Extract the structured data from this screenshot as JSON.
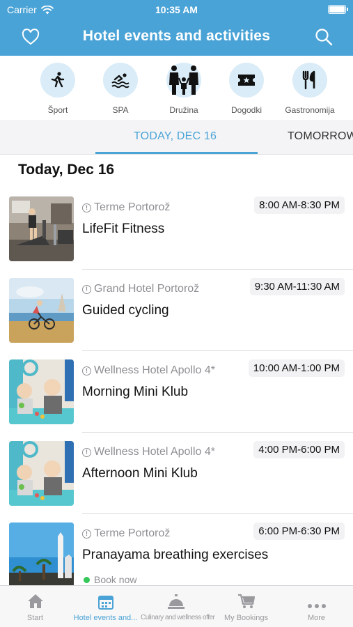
{
  "status": {
    "carrier": "Carrier",
    "time": "10:35 AM"
  },
  "nav": {
    "title": "Hotel events and activities",
    "left_icon": "heart-icon",
    "right_icon": "search-icon"
  },
  "categories": [
    {
      "label": "Šport",
      "icon": "running-icon"
    },
    {
      "label": "SPA",
      "icon": "swimming-icon"
    },
    {
      "label": "Družina",
      "icon": "family-icon"
    },
    {
      "label": "Dogodki",
      "icon": "ticket-icon"
    },
    {
      "label": "Gastronomija",
      "icon": "fork-knife-icon"
    }
  ],
  "date_tabs": {
    "active": "TODAY, DEC 16",
    "next": "TOMORROW"
  },
  "section_title": "Today, Dec 16",
  "events": [
    {
      "location": "Terme Portorož",
      "time": "8:00 AM-8:30 PM",
      "name": "LifeFit Fitness"
    },
    {
      "location": "Grand Hotel Portorož",
      "time": "9:30 AM-11:30 AM",
      "name": "Guided cycling"
    },
    {
      "location": "Wellness Hotel Apollo 4*",
      "time": "10:00 AM-1:00 PM",
      "name": "Morning Mini Klub"
    },
    {
      "location": "Wellness Hotel Apollo 4*",
      "time": "4:00 PM-6:00 PM",
      "name": "Afternoon Mini Klub"
    },
    {
      "location": "Terme Portorož",
      "time": "6:00 PM-6:30 PM",
      "name": "Pranayama breathing exercises",
      "book": "Book now"
    }
  ],
  "tabbar": [
    {
      "label": "Start",
      "icon": "home-icon"
    },
    {
      "label": "Hotel events and...",
      "icon": "calendar-icon",
      "active": true
    },
    {
      "label": "Culinary and wellness offer",
      "icon": "service-bell-icon"
    },
    {
      "label": "My Bookings",
      "icon": "cart-icon"
    },
    {
      "label": "More",
      "icon": "more-icon"
    }
  ],
  "colors": {
    "accent": "#4aa3d6",
    "category_bg": "#d9ecf7",
    "book_dot": "#34c759"
  }
}
